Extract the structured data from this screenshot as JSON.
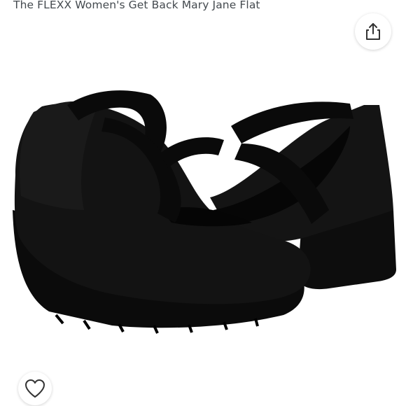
{
  "product": {
    "title": "The FLEXX Women's Get Back Mary Jane Flat"
  },
  "image": {
    "subject": "black-suede-mary-jane-wedge-pair",
    "background": "#ffffff",
    "shoe_color": "#121212"
  },
  "actions": {
    "share_icon": "share-icon",
    "like_icon": "heart-outline-icon"
  }
}
